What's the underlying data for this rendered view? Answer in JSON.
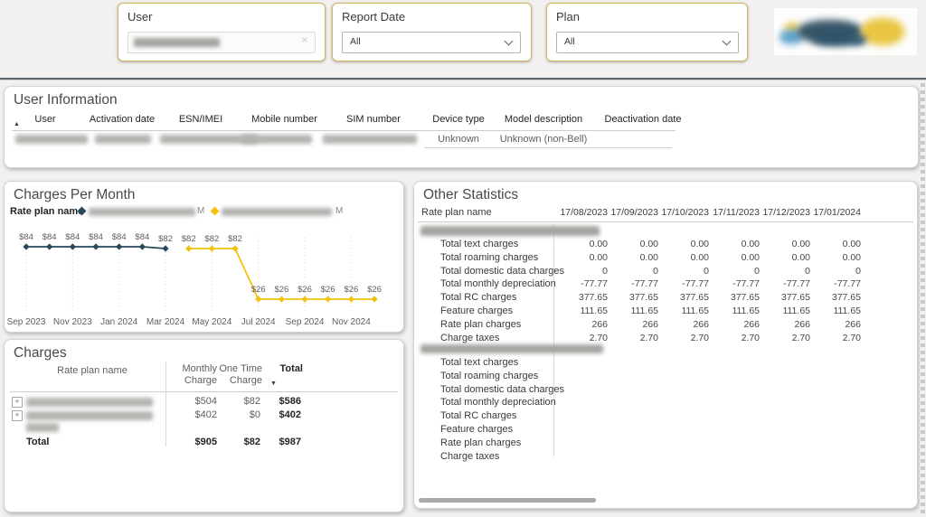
{
  "filters": {
    "user": {
      "label": "User"
    },
    "report_date": {
      "label": "Report Date",
      "value": "All"
    },
    "plan": {
      "label": "Plan",
      "value": "All"
    }
  },
  "user_information": {
    "title": "User Information",
    "columns": [
      "User",
      "Activation date",
      "ESN/IMEI",
      "Mobile number",
      "SIM number",
      "Device type",
      "Model description",
      "Deactivation date"
    ],
    "row": {
      "device_type": "Unknown",
      "model_description": "Unknown (non-Bell)",
      "deactivation_date": ""
    }
  },
  "charges_per_month": {
    "title": "Charges Per Month",
    "legend_title": "Rate plan name",
    "legend_suffix_1": "M",
    "legend_suffix_2": "M",
    "chart_data": {
      "type": "line",
      "x": [
        "Sep 2023",
        "Oct 2023",
        "Nov 2023",
        "Dec 2023",
        "Jan 2024",
        "Feb 2024",
        "Mar 2024",
        "Apr 2024",
        "May 2024",
        "Jun 2024",
        "Jul 2024",
        "Aug 2024",
        "Sep 2024",
        "Oct 2024",
        "Nov 2024",
        "Dec 2024"
      ],
      "x_tick_indices": [
        0,
        2,
        4,
        6,
        8,
        10,
        12,
        14
      ],
      "x_tick_labels": [
        "Sep 2023",
        "Nov 2023",
        "Jan 2024",
        "Mar 2024",
        "May 2024",
        "Jul 2024",
        "Sep 2024",
        "Nov 2024"
      ],
      "series": [
        {
          "name": "rate-plan-1",
          "color": "#26495c",
          "values": [
            84,
            84,
            84,
            84,
            84,
            84,
            82,
            null,
            null,
            null,
            null,
            null,
            null,
            null,
            null,
            null
          ]
        },
        {
          "name": "rate-plan-2",
          "color": "#f2c20d",
          "values": [
            null,
            null,
            null,
            null,
            null,
            null,
            null,
            82,
            82,
            82,
            26,
            26,
            26,
            26,
            26,
            26
          ]
        }
      ],
      "data_label_prefix": "$",
      "grid": "vertical-dotted",
      "legend_position": "top"
    }
  },
  "charges": {
    "title": "Charges",
    "columns": [
      "Rate plan name",
      "Monthly Charge",
      "One Time Charge",
      "Total"
    ],
    "rows": [
      {
        "monthly": "$504",
        "one_time": "$82",
        "total": "$586"
      },
      {
        "monthly": "$402",
        "one_time": "$0",
        "total": "$402"
      }
    ],
    "total_row": {
      "label": "Total",
      "monthly": "$905",
      "one_time": "$82",
      "total": "$987"
    }
  },
  "other_statistics": {
    "title": "Other Statistics",
    "first_column_header": "Rate plan name",
    "date_columns": [
      "17/08/2023",
      "17/09/2023",
      "17/10/2023",
      "17/11/2023",
      "17/12/2023",
      "17/01/2024"
    ],
    "groups": [
      {
        "rows": [
          {
            "label": "Total text charges",
            "values": [
              "0.00",
              "0.00",
              "0.00",
              "0.00",
              "0.00",
              "0.00"
            ]
          },
          {
            "label": "Total roaming charges",
            "values": [
              "0.00",
              "0.00",
              "0.00",
              "0.00",
              "0.00",
              "0.00"
            ]
          },
          {
            "label": "Total domestic data charges",
            "values": [
              "0",
              "0",
              "0",
              "0",
              "0",
              "0"
            ]
          },
          {
            "label": "Total monthly depreciation",
            "values": [
              "-77.77",
              "-77.77",
              "-77.77",
              "-77.77",
              "-77.77",
              "-77.77"
            ]
          },
          {
            "label": "Total RC charges",
            "values": [
              "377.65",
              "377.65",
              "377.65",
              "377.65",
              "377.65",
              "377.65"
            ]
          },
          {
            "label": "Feature charges",
            "values": [
              "111.65",
              "111.65",
              "111.65",
              "111.65",
              "111.65",
              "111.65"
            ]
          },
          {
            "label": "Rate plan charges",
            "values": [
              "266",
              "266",
              "266",
              "266",
              "266",
              "266"
            ]
          },
          {
            "label": "Charge taxes",
            "values": [
              "2.70",
              "2.70",
              "2.70",
              "2.70",
              "2.70",
              "2.70"
            ]
          }
        ]
      },
      {
        "rows": [
          {
            "label": "Total text charges",
            "values": []
          },
          {
            "label": "Total roaming charges",
            "values": []
          },
          {
            "label": "Total domestic data charges",
            "values": []
          },
          {
            "label": "Total monthly depreciation",
            "values": []
          },
          {
            "label": "Total RC charges",
            "values": []
          },
          {
            "label": "Feature charges",
            "values": []
          },
          {
            "label": "Rate plan charges",
            "values": []
          },
          {
            "label": "Charge taxes",
            "values": []
          }
        ]
      }
    ]
  }
}
